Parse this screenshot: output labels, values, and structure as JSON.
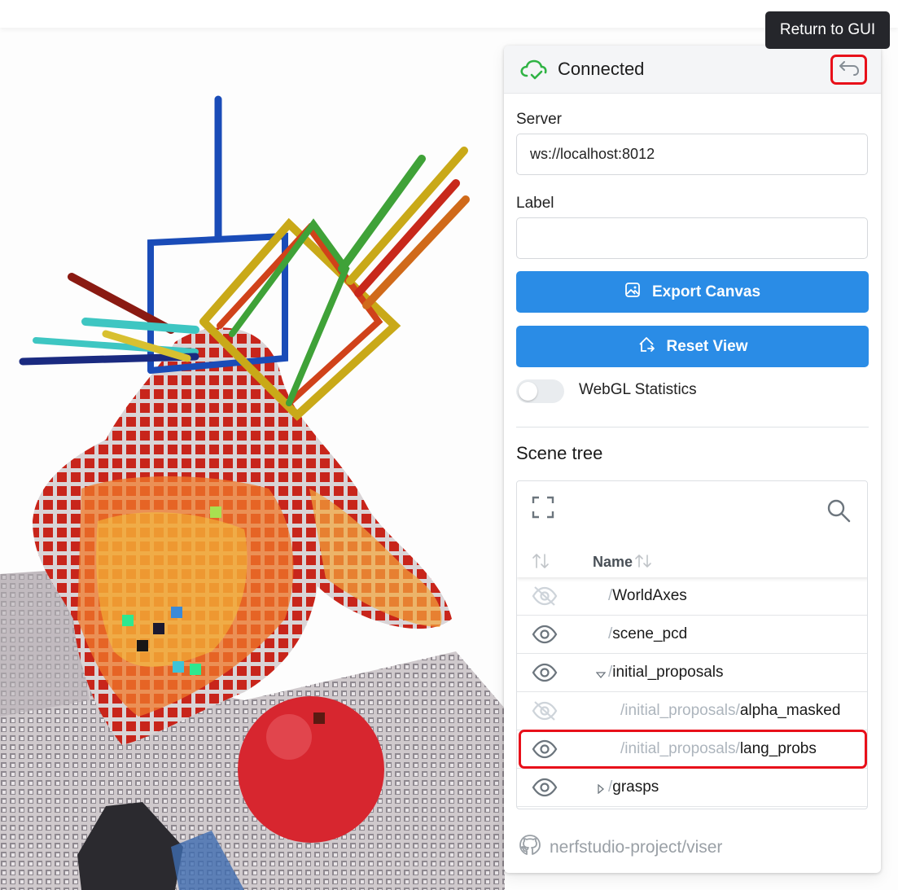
{
  "tooltip": "Return to GUI",
  "header": {
    "status": "Connected"
  },
  "server": {
    "label": "Server",
    "value": "ws://localhost:8012"
  },
  "label_field": {
    "label": "Label",
    "value": ""
  },
  "buttons": {
    "export": "Export Canvas",
    "reset": "Reset View"
  },
  "webgl": {
    "label": "WebGL Statistics",
    "enabled": false
  },
  "scene_tree": {
    "title": "Scene tree",
    "column_name": "Name",
    "rows": [
      {
        "prefix": "/",
        "name": "WorldAxes",
        "visible": false
      },
      {
        "prefix": "/",
        "name": "scene_pcd",
        "visible": true
      },
      {
        "prefix": "/",
        "name": "initial_proposals",
        "visible": true,
        "expanded": true
      },
      {
        "prefix": "/initial_proposals/",
        "name": "alpha_masked",
        "visible": false
      },
      {
        "prefix": "/initial_proposals/",
        "name": "lang_probs",
        "visible": true
      },
      {
        "prefix": "/",
        "name": "grasps",
        "visible": true,
        "expanded": false
      }
    ]
  },
  "footer": {
    "repo": "nerfstudio-project/viser"
  },
  "colors": {
    "accent": "#2a8ce6",
    "highlight": "#e8101a",
    "connected": "#2fb344"
  }
}
